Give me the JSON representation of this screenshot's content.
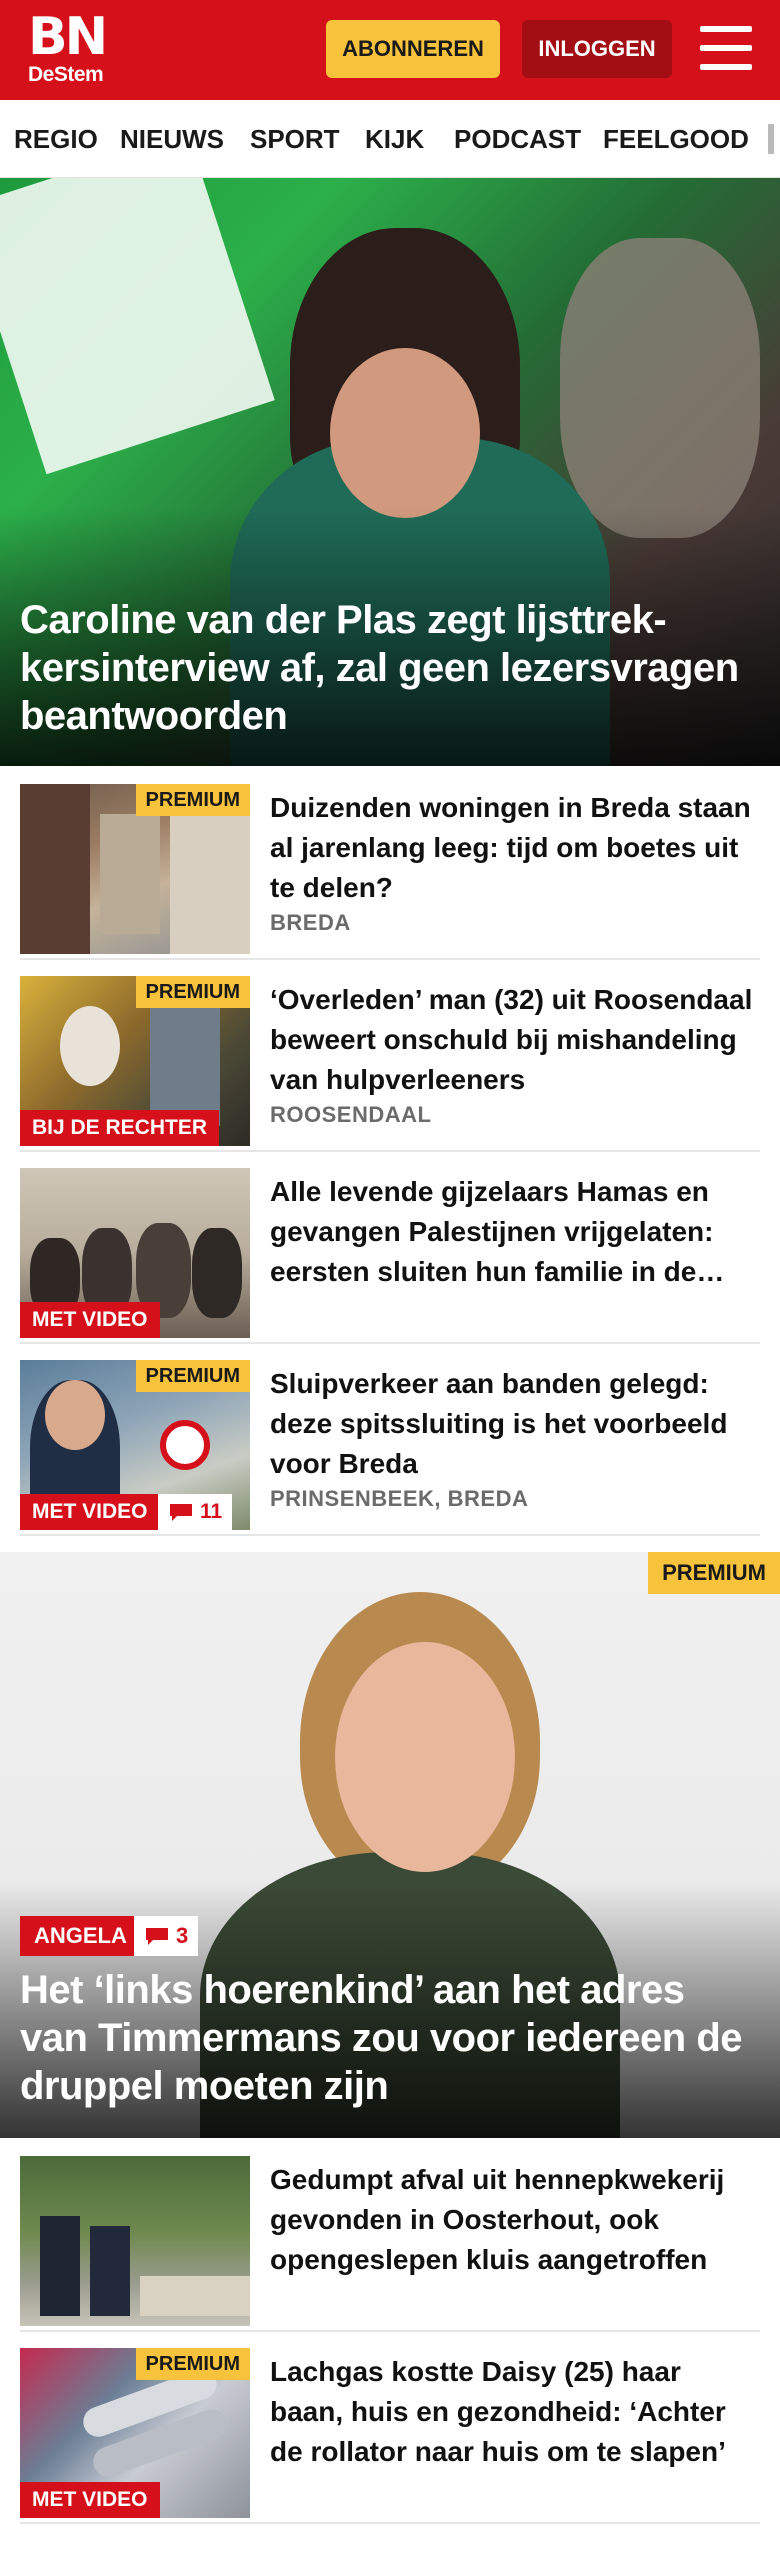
{
  "header": {
    "logo_main": "BN",
    "logo_sub": "DeStem",
    "subscribe_label": "ABONNEREN",
    "login_label": "INLOGGEN",
    "brand_red": "#d5101a",
    "accent_yellow": "#f7c33c",
    "menu_icon": "hamburger-menu-icon"
  },
  "nav": {
    "items": [
      "REGIO",
      "NIEUWS",
      "SPORT",
      "KIJK",
      "PODCAST",
      "FEELGOOD"
    ]
  },
  "hero": {
    "title": "Caroline van der Plas zegt lijsttrek­kersinterview af, zal geen lezersvra­gen beantwoorden"
  },
  "articles": [
    {
      "title": "Duizenden woningen in Breda staan al jarenlang leeg: tijd om boetes uit te delen?",
      "location": "BREDA",
      "premium": "PREMIUM",
      "tag": "",
      "comments": ""
    },
    {
      "title": "‘Overleden’ man (32) uit Roosendaal beweert onschuld bij mishandeling van hulpverleen­ers",
      "location": "ROOSENDAAL",
      "premium": "PREMIUM",
      "tag": "BIJ DE RECHTER",
      "comments": ""
    },
    {
      "title": "Alle levende gijzelaars Hamas en gevangen Palestijnen vrijgela­ten: eersten sluiten hun familie in de armen",
      "location": "",
      "premium": "",
      "tag": "MET VIDEO",
      "comments": ""
    },
    {
      "title": "Sluipverkeer aan banden gelegd: deze spitssluiting is het voorbeeld voor Breda",
      "location": "PRINSENBEEK, BREDA",
      "premium": "PREMIUM",
      "tag": "MET VIDEO",
      "comments": "11"
    }
  ],
  "feature": {
    "premium": "PREMIUM",
    "tag": "ANGELA",
    "comments": "3",
    "title": "Het ‘links hoerenkind’ aan het adres van Timmermans zou voor iedereen de druppel moeten zijn"
  },
  "articles_bottom": [
    {
      "title": "Gedumpt afval uit hennepkweke­rij gevonden in Oosterhout, ook opengeslepen kluis aangetroffen",
      "location": "",
      "premium": "",
      "tag": ""
    },
    {
      "title": "Lachgas kostte Daisy (25) haar baan, huis en gezondheid: ‘Achter de rollator naar huis om te slapen’",
      "location": "",
      "premium": "PREMIUM",
      "tag": "MET VIDEO"
    }
  ]
}
